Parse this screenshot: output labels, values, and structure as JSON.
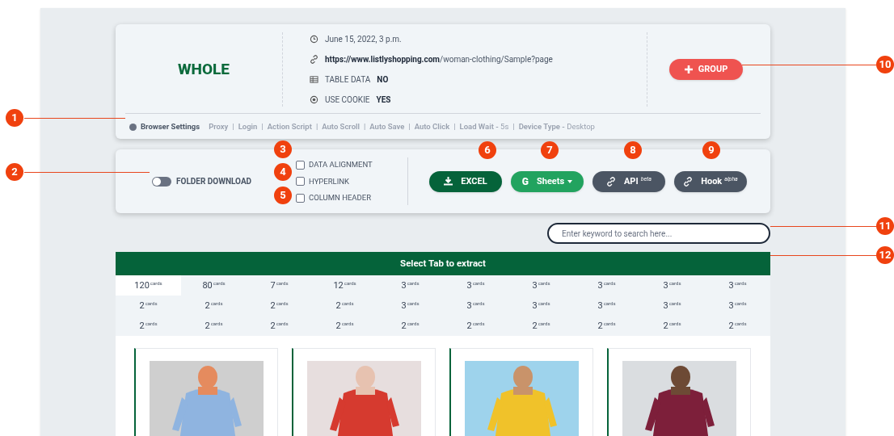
{
  "source": {
    "name": "WHOLE",
    "date": "June 15, 2022, 3 p.m.",
    "url_bold": "https://www.listlyshopping.com",
    "url_rest": "/woman-clothing/Sample?page",
    "facts": [
      {
        "label": "TABLE DATA",
        "value": "NO"
      },
      {
        "label": "USE COOKIE",
        "value": "YES"
      }
    ],
    "group_button": "GROUP"
  },
  "browser_settings": {
    "title": "Browser Settings",
    "separator": "|",
    "value_dash": "-",
    "items": [
      {
        "label": "Proxy"
      },
      {
        "label": "Login"
      },
      {
        "label": "Action Script"
      },
      {
        "label": "Auto Scroll"
      },
      {
        "label": "Auto Save"
      },
      {
        "label": "Auto Click"
      },
      {
        "label": "Load Wait",
        "value": "5s"
      },
      {
        "label": "Device Type",
        "value": "Desktop"
      }
    ]
  },
  "folder_download": {
    "label": "FOLDER DOWNLOAD",
    "on": false
  },
  "options": [
    {
      "label": "DATA ALIGNMENT",
      "checked": false
    },
    {
      "label": "HYPERLINK",
      "checked": false
    },
    {
      "label": "COLUMN HEADER",
      "checked": false
    }
  ],
  "export_buttons": [
    {
      "kind": "excel",
      "label": "EXCEL"
    },
    {
      "kind": "sheets",
      "label": "Sheets",
      "icon_text": "G"
    },
    {
      "kind": "api",
      "label": "API",
      "tag": "beta"
    },
    {
      "kind": "hook",
      "label": "Hook",
      "tag": "alpha"
    }
  ],
  "search": {
    "placeholder": "Enter keyword to search here..."
  },
  "tabs_header": "Select Tab to extract",
  "tabs": [
    {
      "count": "120",
      "unit": "cards",
      "selected": true
    },
    {
      "count": "80",
      "unit": "cards",
      "selected": false
    },
    {
      "count": "7",
      "unit": "cards",
      "selected": false
    },
    {
      "count": "12",
      "unit": "cards",
      "selected": false
    },
    {
      "count": "3",
      "unit": "cards",
      "selected": false
    },
    {
      "count": "3",
      "unit": "cards",
      "selected": false
    },
    {
      "count": "3",
      "unit": "cards",
      "selected": false
    },
    {
      "count": "3",
      "unit": "cards",
      "selected": false
    },
    {
      "count": "3",
      "unit": "cards",
      "selected": false
    },
    {
      "count": "3",
      "unit": "cards",
      "selected": false
    },
    {
      "count": "2",
      "unit": "cards",
      "selected": false
    },
    {
      "count": "2",
      "unit": "cards",
      "selected": false
    },
    {
      "count": "2",
      "unit": "cards",
      "selected": false
    },
    {
      "count": "2",
      "unit": "cards",
      "selected": false
    },
    {
      "count": "3",
      "unit": "cards",
      "selected": false
    },
    {
      "count": "3",
      "unit": "cards",
      "selected": false
    },
    {
      "count": "3",
      "unit": "cards",
      "selected": false
    },
    {
      "count": "3",
      "unit": "cards",
      "selected": false
    },
    {
      "count": "3",
      "unit": "cards",
      "selected": false
    },
    {
      "count": "3",
      "unit": "cards",
      "selected": false
    },
    {
      "count": "2",
      "unit": "cards",
      "selected": false
    },
    {
      "count": "2",
      "unit": "cards",
      "selected": false
    },
    {
      "count": "2",
      "unit": "cards",
      "selected": false
    },
    {
      "count": "2",
      "unit": "cards",
      "selected": false
    },
    {
      "count": "2",
      "unit": "cards",
      "selected": false
    },
    {
      "count": "2",
      "unit": "cards",
      "selected": false
    },
    {
      "count": "2",
      "unit": "cards",
      "selected": false
    },
    {
      "count": "2",
      "unit": "cards",
      "selected": false
    },
    {
      "count": "2",
      "unit": "cards",
      "selected": false
    },
    {
      "count": "2",
      "unit": "cards",
      "selected": false
    }
  ],
  "callouts": [
    {
      "number": "1"
    },
    {
      "number": "2"
    },
    {
      "number": "3"
    },
    {
      "number": "4"
    },
    {
      "number": "5"
    },
    {
      "number": "6"
    },
    {
      "number": "7"
    },
    {
      "number": "8"
    },
    {
      "number": "9"
    },
    {
      "number": "10"
    },
    {
      "number": "11"
    },
    {
      "number": "12"
    }
  ]
}
